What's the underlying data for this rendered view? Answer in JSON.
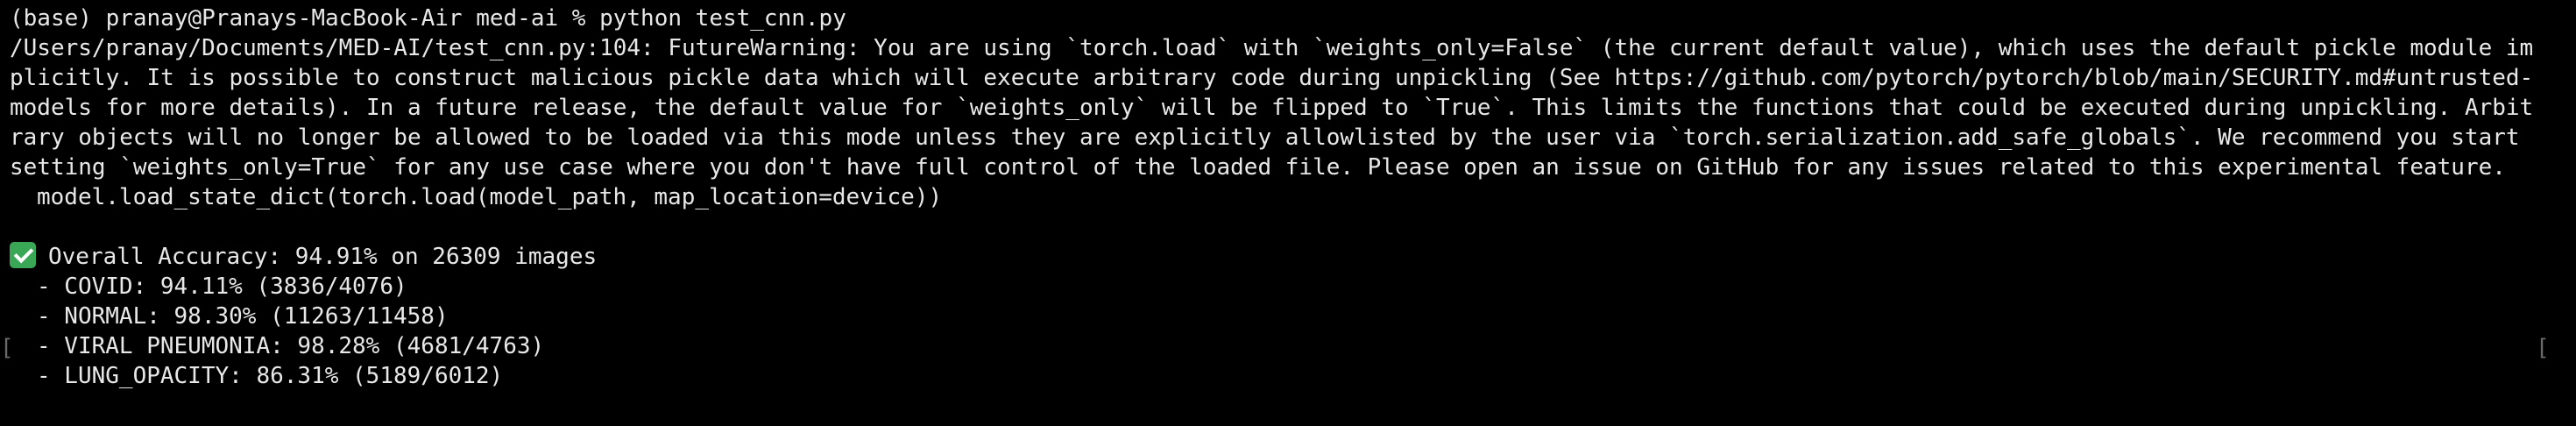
{
  "terminal": {
    "prompt": "(base) pranay@Pranays-MacBook-Air med-ai % python test_cnn.py",
    "warning": "/Users/pranay/Documents/MED-AI/test_cnn.py:104: FutureWarning: You are using `torch.load` with `weights_only=False` (the current default value), which uses the default pickle module implicitly. It is possible to construct malicious pickle data which will execute arbitrary code during unpickling (See https://github.com/pytorch/pytorch/blob/main/SECURITY.md#untrusted-models for more details). In a future release, the default value for `weights_only` will be flipped to `True`. This limits the functions that could be executed during unpickling. Arbitrary objects will no longer be allowed to be loaded via this mode unless they are explicitly allowlisted by the user via `torch.serialization.add_safe_globals`. We recommend you start setting `weights_only=True` for any use case where you don't have full control of the loaded file. Please open an issue on GitHub for any issues related to this experimental feature.",
    "code_line": "model.load_state_dict(torch.load(model_path, map_location=device))",
    "accuracy_line": "Overall Accuracy: 94.91% on 26309 images",
    "results": [
      "- COVID: 94.11% (3836/4076)",
      "- NORMAL: 98.30% (11263/11458)",
      "- VIRAL PNEUMONIA: 98.28% (4681/4763)",
      "- LUNG_OPACITY: 86.31% (5189/6012)"
    ],
    "left_bracket": "[",
    "right_bracket": "["
  },
  "colors": {
    "background": "#000000",
    "text": "#e8e8e8",
    "check_icon": "#3aa757"
  }
}
